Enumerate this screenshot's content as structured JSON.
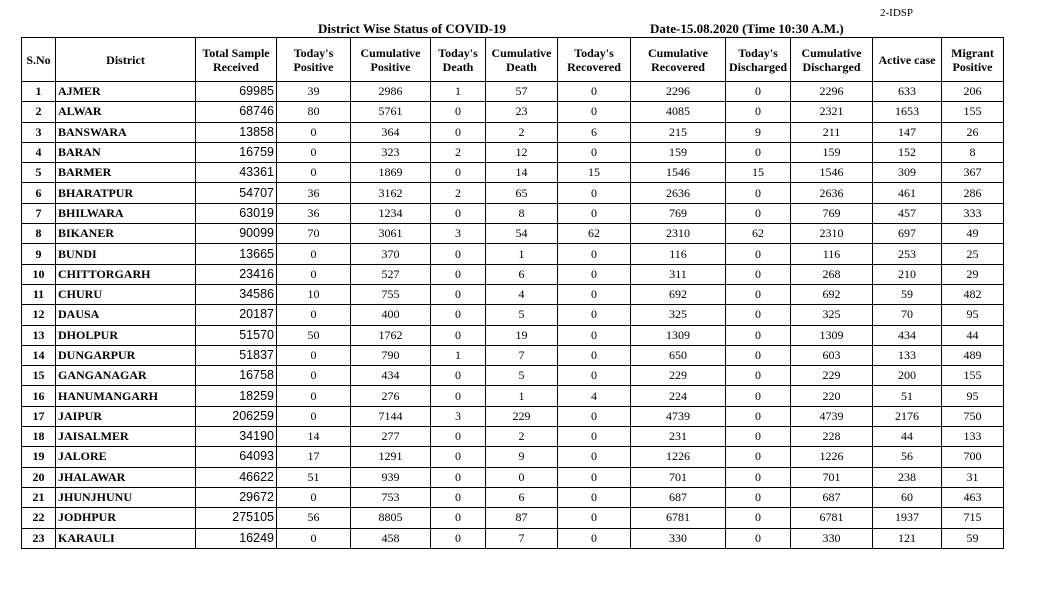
{
  "header_code": "2-IDSP",
  "title": "District Wise Status of  COVID-19",
  "date": "Date-15.08.2020 (Time 10:30 A.M.)",
  "columns": [
    "S.No",
    "District",
    "Total Sample Received",
    "Today's Positive",
    "Cumulative Positive",
    "Today's Death",
    "Cumulative Death",
    "Today's Recovered",
    "Cumulative Recovered",
    "Today's Discharged",
    "Cumulative Discharged",
    "Active case",
    "Migrant Positive"
  ],
  "rows": [
    [
      "1",
      "AJMER",
      "69985",
      "39",
      "2986",
      "1",
      "57",
      "0",
      "2296",
      "0",
      "2296",
      "633",
      "206"
    ],
    [
      "2",
      "ALWAR",
      "68746",
      "80",
      "5761",
      "0",
      "23",
      "0",
      "4085",
      "0",
      "2321",
      "1653",
      "155"
    ],
    [
      "3",
      "BANSWARA",
      "13858",
      "0",
      "364",
      "0",
      "2",
      "6",
      "215",
      "9",
      "211",
      "147",
      "26"
    ],
    [
      "4",
      "BARAN",
      "16759",
      "0",
      "323",
      "2",
      "12",
      "0",
      "159",
      "0",
      "159",
      "152",
      "8"
    ],
    [
      "5",
      "BARMER",
      "43361",
      "0",
      "1869",
      "0",
      "14",
      "15",
      "1546",
      "15",
      "1546",
      "309",
      "367"
    ],
    [
      "6",
      "BHARATPUR",
      "54707",
      "36",
      "3162",
      "2",
      "65",
      "0",
      "2636",
      "0",
      "2636",
      "461",
      "286"
    ],
    [
      "7",
      "BHILWARA",
      "63019",
      "36",
      "1234",
      "0",
      "8",
      "0",
      "769",
      "0",
      "769",
      "457",
      "333"
    ],
    [
      "8",
      "BIKANER",
      "90099",
      "70",
      "3061",
      "3",
      "54",
      "62",
      "2310",
      "62",
      "2310",
      "697",
      "49"
    ],
    [
      "9",
      "BUNDI",
      "13665",
      "0",
      "370",
      "0",
      "1",
      "0",
      "116",
      "0",
      "116",
      "253",
      "25"
    ],
    [
      "10",
      "CHITTORGARH",
      "23416",
      "0",
      "527",
      "0",
      "6",
      "0",
      "311",
      "0",
      "268",
      "210",
      "29"
    ],
    [
      "11",
      "CHURU",
      "34586",
      "10",
      "755",
      "0",
      "4",
      "0",
      "692",
      "0",
      "692",
      "59",
      "482"
    ],
    [
      "12",
      "DAUSA",
      "20187",
      "0",
      "400",
      "0",
      "5",
      "0",
      "325",
      "0",
      "325",
      "70",
      "95"
    ],
    [
      "13",
      "DHOLPUR",
      "51570",
      "50",
      "1762",
      "0",
      "19",
      "0",
      "1309",
      "0",
      "1309",
      "434",
      "44"
    ],
    [
      "14",
      "DUNGARPUR",
      "51837",
      "0",
      "790",
      "1",
      "7",
      "0",
      "650",
      "0",
      "603",
      "133",
      "489"
    ],
    [
      "15",
      "GANGANAGAR",
      "16758",
      "0",
      "434",
      "0",
      "5",
      "0",
      "229",
      "0",
      "229",
      "200",
      "155"
    ],
    [
      "16",
      "HANUMANGARH",
      "18259",
      "0",
      "276",
      "0",
      "1",
      "4",
      "224",
      "0",
      "220",
      "51",
      "95"
    ],
    [
      "17",
      "JAIPUR",
      "206259",
      "0",
      "7144",
      "3",
      "229",
      "0",
      "4739",
      "0",
      "4739",
      "2176",
      "750"
    ],
    [
      "18",
      "JAISALMER",
      "34190",
      "14",
      "277",
      "0",
      "2",
      "0",
      "231",
      "0",
      "228",
      "44",
      "133"
    ],
    [
      "19",
      "JALORE",
      "64093",
      "17",
      "1291",
      "0",
      "9",
      "0",
      "1226",
      "0",
      "1226",
      "56",
      "700"
    ],
    [
      "20",
      "JHALAWAR",
      "46622",
      "51",
      "939",
      "0",
      "0",
      "0",
      "701",
      "0",
      "701",
      "238",
      "31"
    ],
    [
      "21",
      "JHUNJHUNU",
      "29672",
      "0",
      "753",
      "0",
      "6",
      "0",
      "687",
      "0",
      "687",
      "60",
      "463"
    ],
    [
      "22",
      "JODHPUR",
      "275105",
      "56",
      "8805",
      "0",
      "87",
      "0",
      "6781",
      "0",
      "6781",
      "1937",
      "715"
    ],
    [
      "23",
      "KARAULI",
      "16249",
      "0",
      "458",
      "0",
      "7",
      "0",
      "330",
      "0",
      "330",
      "121",
      "59"
    ]
  ]
}
